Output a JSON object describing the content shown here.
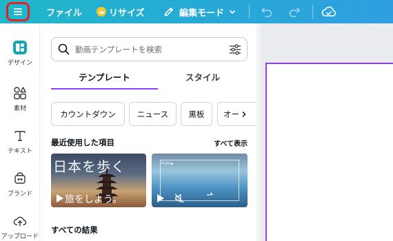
{
  "topbar": {
    "file_label": "ファイル",
    "resize_label": "リサイズ",
    "edit_mode_label": "編集モード"
  },
  "leftnav": {
    "items": [
      {
        "label": "デザイン",
        "icon": "design-icon"
      },
      {
        "label": "素材",
        "icon": "elements-icon"
      },
      {
        "label": "テキスト",
        "icon": "text-icon"
      },
      {
        "label": "ブランド",
        "icon": "brand-icon"
      },
      {
        "label": "アップロード",
        "icon": "upload-icon"
      }
    ]
  },
  "panel": {
    "search": {
      "placeholder": "動画テンプレートを検索"
    },
    "tabs": [
      {
        "label": "テンプレート",
        "active": true
      },
      {
        "label": "スタイル",
        "active": false
      }
    ],
    "chips": [
      "カウントダウン",
      "ニュース",
      "黒板",
      "オー"
    ],
    "recent": {
      "title": "最近使用した項目",
      "see_all": "すべて表示",
      "thumb1_text_top": "日本を歩く",
      "thumb1_text_bottom": "旅をしよう。",
      "thumb2_play_label": "PLAY ▶"
    },
    "all_results_title": "すべての結果"
  },
  "colors": {
    "topbar_gradient_start": "#1fb7c9",
    "topbar_gradient_end": "#2f9fe0",
    "accent_purple": "#8b3dff",
    "menu_highlight": "#e1202a"
  }
}
